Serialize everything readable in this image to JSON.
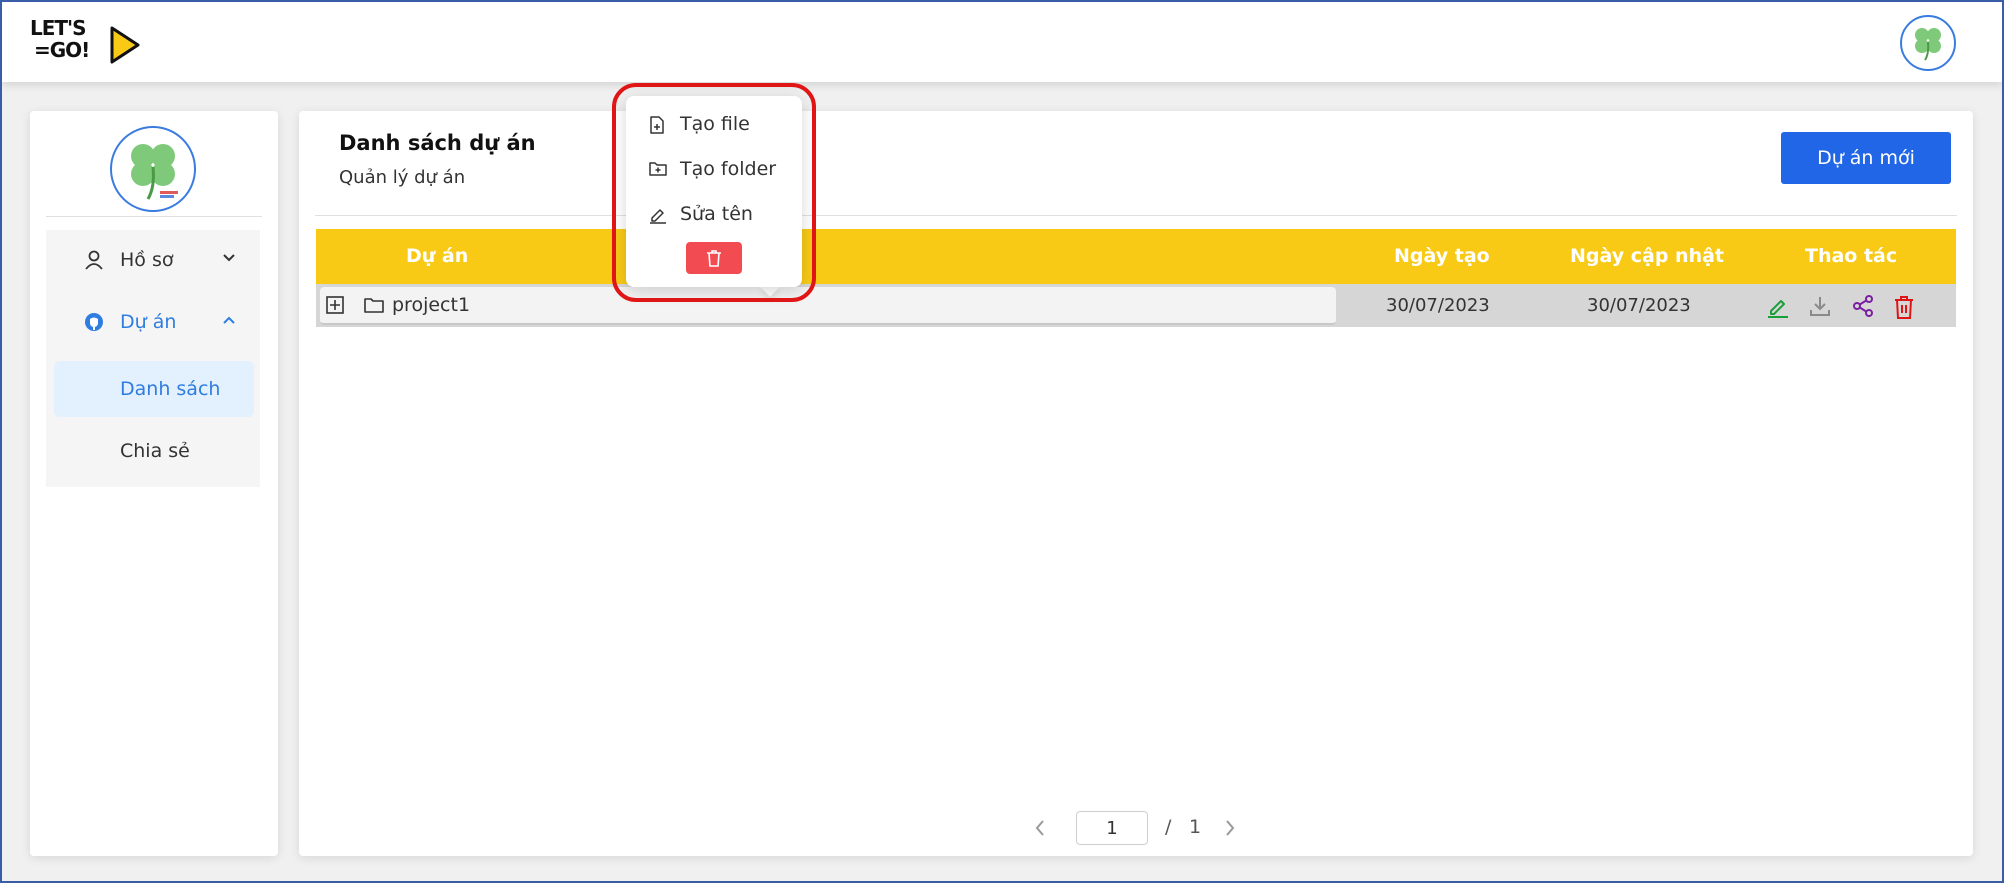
{
  "header": {
    "logo_line1": "LET'S",
    "logo_line2": "=GO!"
  },
  "sidebar": {
    "items": [
      {
        "label": "Hồ sơ",
        "icon": "user-icon",
        "chevron": "chevron-down-icon"
      },
      {
        "label": "Dự án",
        "icon": "github-icon",
        "chevron": "chevron-up-icon"
      }
    ],
    "subitems": [
      {
        "label": "Danh sách",
        "active": true
      },
      {
        "label": "Chia sẻ",
        "active": false
      }
    ]
  },
  "main": {
    "title": "Danh sách dự án",
    "subtitle": "Quản lý dự án",
    "new_button": "Dự án mới"
  },
  "table": {
    "headers": [
      "Dự án",
      "Ngày tạo",
      "Ngày cập nhật",
      "Thao tác"
    ],
    "rows": [
      {
        "name": "project1",
        "created": "30/07/2023",
        "updated": "30/07/2023"
      }
    ]
  },
  "context_menu": {
    "items": [
      {
        "label": "Tạo file",
        "icon": "file-plus-icon"
      },
      {
        "label": "Tạo folder",
        "icon": "folder-plus-icon"
      },
      {
        "label": "Sửa tên",
        "icon": "edit-icon"
      }
    ],
    "delete_icon": "trash-icon"
  },
  "pagination": {
    "current": "1",
    "separator": "/",
    "total": "1"
  },
  "colors": {
    "accent_blue": "#2166e6",
    "header_yellow": "#f8ca16",
    "delete_red": "#f34b52",
    "highlight_red": "#e01515",
    "edit_green": "#1a9e3a",
    "share_purple": "#7a1fa2"
  }
}
